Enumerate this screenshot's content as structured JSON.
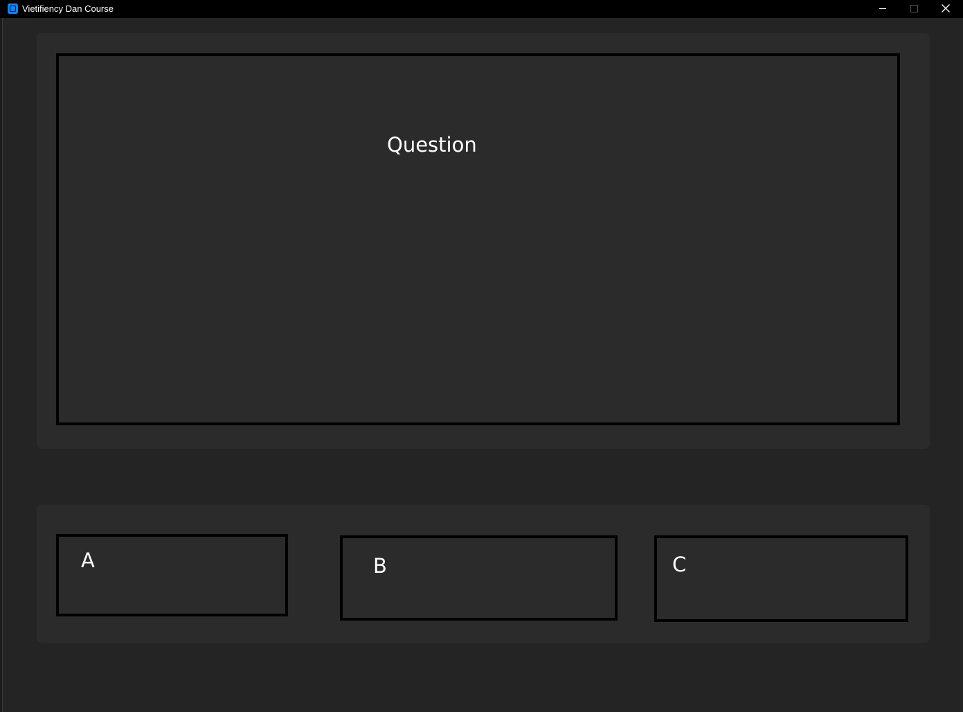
{
  "window": {
    "title": "Vietifiency Dan Course"
  },
  "question": {
    "text": "Question"
  },
  "answers": [
    {
      "label": "A"
    },
    {
      "label": "B"
    },
    {
      "label": "C"
    }
  ],
  "colors": {
    "background": "#242424",
    "panel": "#2b2b2b",
    "titlebar": "#000000",
    "text": "#ffffff",
    "app_icon": "#0a84ff"
  },
  "icons": {
    "app": "app-icon",
    "minimize": "minimize-icon",
    "maximize": "maximize-icon",
    "close": "close-icon"
  }
}
